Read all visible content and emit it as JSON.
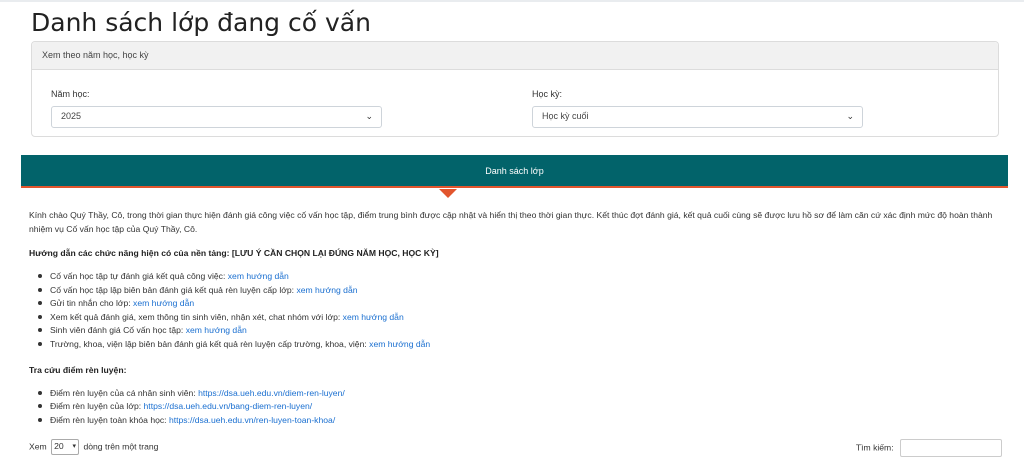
{
  "page": {
    "title": "Danh sách lớp đang cố vấn"
  },
  "filter": {
    "header": "Xem theo năm học, học kỳ",
    "year_label": "Năm học:",
    "year_value": "2025",
    "semester_label": "Học kỳ:",
    "semester_value": "Học kỳ cuối"
  },
  "banner": {
    "label": "Danh sách lớp"
  },
  "intro": "Kính chào Quý Thầy, Cô, trong thời gian thực hiện đánh giá công việc cố vấn học tập, điểm trung bình được cập nhật và hiển thị theo thời gian thực. Kết thúc đợt đánh giá, kết quả cuối cùng sẽ được lưu hồ sơ để làm căn cứ xác định mức độ hoàn thành nhiệm vụ Cố vấn học tập của Quý Thầy, Cô.",
  "guide": {
    "heading": "Hướng dẫn các chức năng hiện có của nền tảng: [LƯU Ý CẦN CHỌN LẠI ĐÚNG NĂM HỌC, HỌC KỲ]",
    "items": [
      {
        "text": "Cố vấn học tập tự đánh giá kết quả công việc: ",
        "link": "xem hướng dẫn"
      },
      {
        "text": "Cố vấn học tập lập biên bản đánh giá kết quả rèn luyện cấp lớp: ",
        "link": "xem hướng dẫn"
      },
      {
        "text": "Gửi tin nhắn cho lớp: ",
        "link": "xem hướng dẫn"
      },
      {
        "text": "Xem kết quả đánh giá, xem thông tin sinh viên, nhận xét, chat nhóm với lớp: ",
        "link": "xem hướng dẫn"
      },
      {
        "text": "Sinh viên đánh giá Cố vấn học tập: ",
        "link": "xem hướng dẫn"
      },
      {
        "text": "Trường, khoa, viện lập biên bản đánh giá kết quả rèn luyện cấp trường, khoa, viện: ",
        "link": "xem hướng dẫn"
      }
    ]
  },
  "lookup": {
    "heading": "Tra cứu điểm rèn luyện:",
    "items": [
      {
        "text": "Điểm rèn luyện của cá nhân sinh viên: ",
        "link": "https://dsa.ueh.edu.vn/diem-ren-luyen/"
      },
      {
        "text": "Điểm rèn luyện của lớp: ",
        "link": "https://dsa.ueh.edu.vn/bang-diem-ren-luyen/"
      },
      {
        "text": "Điểm rèn luyện toàn khóa học: ",
        "link": "https://dsa.ueh.edu.vn/ren-luyen-toan-khoa/"
      }
    ]
  },
  "table_controls": {
    "show_prefix": "Xem",
    "page_length": "20",
    "show_suffix": "dòng trên một trang",
    "search_label": "Tìm kiếm:"
  }
}
